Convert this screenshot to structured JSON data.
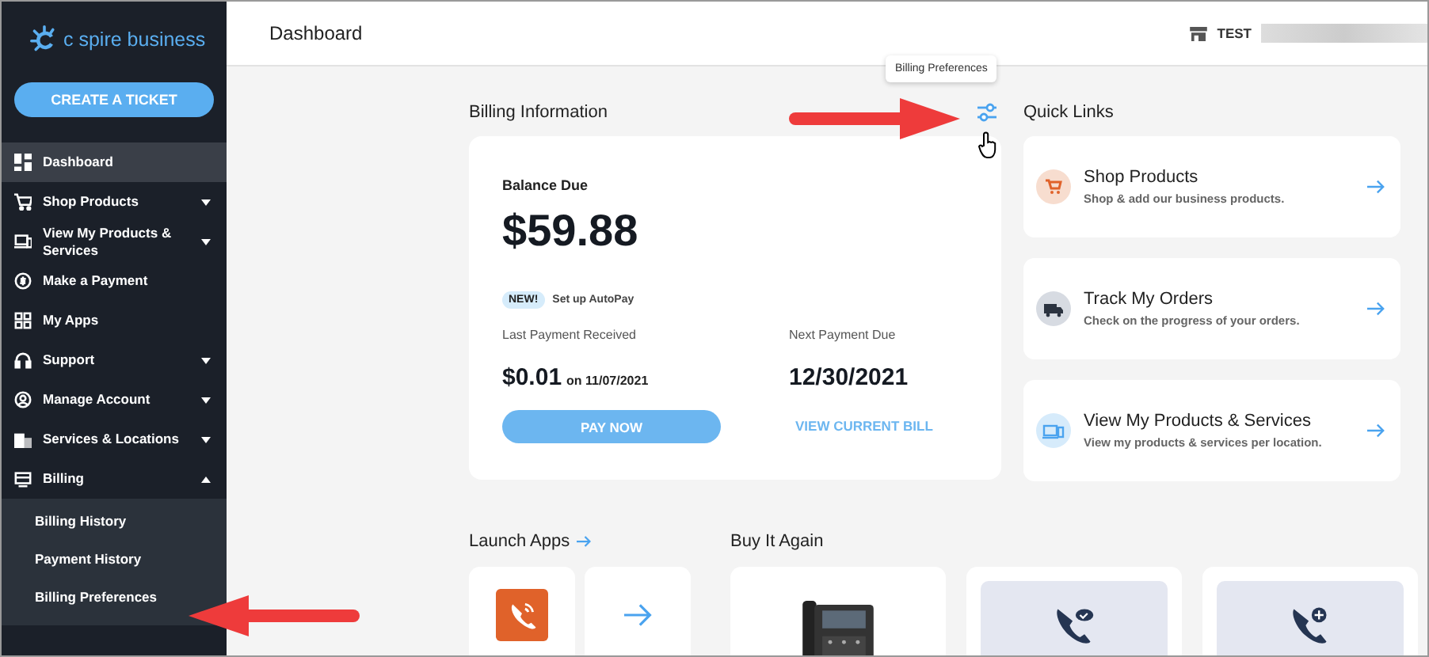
{
  "logo": {
    "text": "c spire business"
  },
  "sidebar": {
    "button": "CREATE A TICKET",
    "items": [
      {
        "label": "Dashboard",
        "selected": true
      },
      {
        "label": "Shop Products",
        "selected": false,
        "expanded": false
      },
      {
        "label": "View My Products & Services",
        "selected": false,
        "expanded": false
      },
      {
        "label": "Make a Payment",
        "selected": false
      },
      {
        "label": "My Apps",
        "selected": false
      },
      {
        "label": "Support",
        "selected": false,
        "expanded": false
      },
      {
        "label": "Manage Account",
        "selected": false,
        "expanded": false
      },
      {
        "label": "Services & Locations",
        "selected": false,
        "expanded": false
      },
      {
        "label": "Billing",
        "selected": false,
        "expanded": true,
        "children": [
          {
            "label": "Billing History",
            "selected": false
          },
          {
            "label": "Payment History",
            "selected": false
          },
          {
            "label": "Billing Preferences",
            "selected": false
          }
        ]
      }
    ]
  },
  "header": {
    "title": "Dashboard",
    "account": "TEST"
  },
  "tooltip": "Billing Preferences",
  "billing": {
    "heading": "Billing Information",
    "balance_label": "Balance Due",
    "balance": "$59.88",
    "badge": "NEW!",
    "autopay": "Set up AutoPay",
    "last_label": "Last Payment Received",
    "last_amount": "$0.01",
    "last_date": "on 11/07/2021",
    "next_label": "Next Payment Due",
    "next_date": "12/30/2021",
    "pay_button": "PAY NOW",
    "view_bill": "VIEW CURRENT BILL"
  },
  "quick_links": {
    "heading": "Quick Links",
    "items": [
      {
        "title": "Shop Products",
        "subtitle": "Shop & add our business products."
      },
      {
        "title": "Track My Orders",
        "subtitle": "Check on the progress of your orders."
      },
      {
        "title": "View My Products & Services",
        "subtitle": "View my products & services per location."
      }
    ]
  },
  "launch_apps": {
    "heading": "Launch Apps"
  },
  "buy_again": {
    "heading": "Buy It Again"
  }
}
